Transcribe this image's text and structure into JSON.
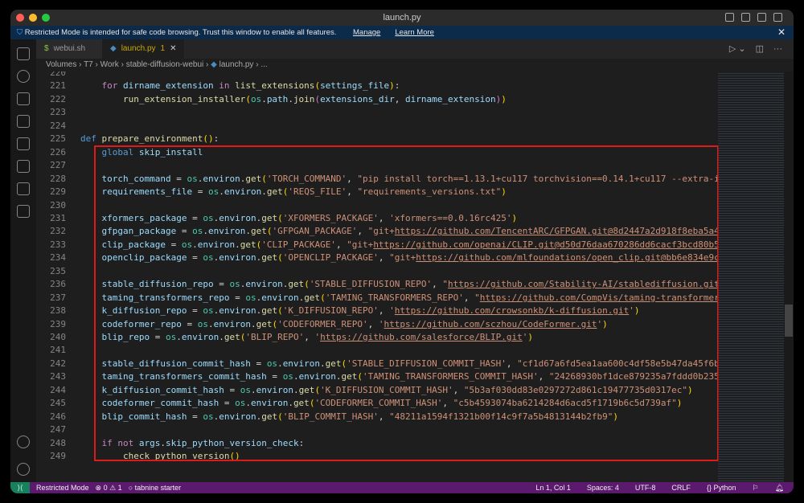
{
  "window": {
    "title": "launch.py"
  },
  "banner": {
    "text": "Restricted Mode is intended for safe code browsing. Trust this window to enable all features.",
    "manage": "Manage",
    "learn_more": "Learn More"
  },
  "tabs": [
    {
      "label": "webui.sh",
      "icon": "$"
    },
    {
      "label": "launch.py",
      "badge": "1"
    }
  ],
  "breadcrumb": [
    "Volumes",
    "T7",
    "Work",
    "stable-diffusion-webui",
    "launch.py",
    "..."
  ],
  "colors": {
    "status_bar": "#5c1a6e",
    "banner": "#0c2a4a",
    "highlight_box": "#e0191b"
  },
  "code": [
    {
      "n": "220",
      "t": []
    },
    {
      "n": "221",
      "t": [
        [
          "t",
          "    "
        ],
        [
          "c",
          "for"
        ],
        [
          "t",
          " "
        ],
        [
          "v",
          "dirname_extension"
        ],
        [
          "t",
          " "
        ],
        [
          "c",
          "in"
        ],
        [
          "t",
          " "
        ],
        [
          "f",
          "list_extensions"
        ],
        [
          "b",
          "("
        ],
        [
          "v",
          "settings_file"
        ],
        [
          "b",
          ")"
        ],
        [
          "t",
          ":"
        ]
      ]
    },
    {
      "n": "222",
      "t": [
        [
          "t",
          "        "
        ],
        [
          "f",
          "run_extension_installer"
        ],
        [
          "b",
          "("
        ],
        [
          "m",
          "os"
        ],
        [
          "t",
          "."
        ],
        [
          "v",
          "path"
        ],
        [
          "t",
          "."
        ],
        [
          "f",
          "join"
        ],
        [
          "p",
          "("
        ],
        [
          "v",
          "extensions_dir"
        ],
        [
          "t",
          ", "
        ],
        [
          "v",
          "dirname_extension"
        ],
        [
          "p",
          ")"
        ],
        [
          "b",
          ")"
        ]
      ]
    },
    {
      "n": "223",
      "t": []
    },
    {
      "n": "224",
      "t": []
    },
    {
      "n": "225",
      "t": [
        [
          "k",
          "def"
        ],
        [
          "t",
          " "
        ],
        [
          "f",
          "prepare_environment"
        ],
        [
          "b",
          "()"
        ],
        [
          "t",
          ":"
        ]
      ]
    },
    {
      "n": "226",
      "t": [
        [
          "t",
          "    "
        ],
        [
          "k",
          "global"
        ],
        [
          "t",
          " "
        ],
        [
          "v",
          "skip_install"
        ]
      ]
    },
    {
      "n": "227",
      "t": []
    },
    {
      "n": "228",
      "t": [
        [
          "t",
          "    "
        ],
        [
          "v",
          "torch_command"
        ],
        [
          "t",
          " = "
        ],
        [
          "m",
          "os"
        ],
        [
          "t",
          "."
        ],
        [
          "v",
          "environ"
        ],
        [
          "t",
          "."
        ],
        [
          "f",
          "get"
        ],
        [
          "b",
          "("
        ],
        [
          "s",
          "'TORCH_COMMAND'"
        ],
        [
          "t",
          ", "
        ],
        [
          "s",
          "\"pip install torch==1.13.1+cu117 torchvision==0.14.1+cu117 --extra-i"
        ]
      ]
    },
    {
      "n": "229",
      "t": [
        [
          "t",
          "    "
        ],
        [
          "v",
          "requirements_file"
        ],
        [
          "t",
          " = "
        ],
        [
          "m",
          "os"
        ],
        [
          "t",
          "."
        ],
        [
          "v",
          "environ"
        ],
        [
          "t",
          "."
        ],
        [
          "f",
          "get"
        ],
        [
          "b",
          "("
        ],
        [
          "s",
          "'REQS_FILE'"
        ],
        [
          "t",
          ", "
        ],
        [
          "s",
          "\"requirements_versions.txt\""
        ],
        [
          "b",
          ")"
        ]
      ]
    },
    {
      "n": "230",
      "t": []
    },
    {
      "n": "231",
      "t": [
        [
          "t",
          "    "
        ],
        [
          "v",
          "xformers_package"
        ],
        [
          "t",
          " = "
        ],
        [
          "m",
          "os"
        ],
        [
          "t",
          "."
        ],
        [
          "v",
          "environ"
        ],
        [
          "t",
          "."
        ],
        [
          "f",
          "get"
        ],
        [
          "b",
          "("
        ],
        [
          "s",
          "'XFORMERS_PACKAGE'"
        ],
        [
          "t",
          ", "
        ],
        [
          "s",
          "'xformers==0.0.16rc425'"
        ],
        [
          "b",
          ")"
        ]
      ]
    },
    {
      "n": "232",
      "t": [
        [
          "t",
          "    "
        ],
        [
          "v",
          "gfpgan_package"
        ],
        [
          "t",
          " = "
        ],
        [
          "m",
          "os"
        ],
        [
          "t",
          "."
        ],
        [
          "v",
          "environ"
        ],
        [
          "t",
          "."
        ],
        [
          "f",
          "get"
        ],
        [
          "b",
          "("
        ],
        [
          "s",
          "'GFPGAN_PACKAGE'"
        ],
        [
          "t",
          ", "
        ],
        [
          "s",
          "\"git+"
        ],
        [
          "u",
          "https://github.com/TencentARC/GFPGAN.git@8d2447a2d918f8eba5a4"
        ]
      ]
    },
    {
      "n": "233",
      "t": [
        [
          "t",
          "    "
        ],
        [
          "v",
          "clip_package"
        ],
        [
          "t",
          " = "
        ],
        [
          "m",
          "os"
        ],
        [
          "t",
          "."
        ],
        [
          "v",
          "environ"
        ],
        [
          "t",
          "."
        ],
        [
          "f",
          "get"
        ],
        [
          "b",
          "("
        ],
        [
          "s",
          "'CLIP_PACKAGE'"
        ],
        [
          "t",
          ", "
        ],
        [
          "s",
          "\"git+"
        ],
        [
          "u",
          "https://github.com/openai/CLIP.git@d50d76daa670286dd6cacf3bcd80b5"
        ]
      ]
    },
    {
      "n": "234",
      "t": [
        [
          "t",
          "    "
        ],
        [
          "v",
          "openclip_package"
        ],
        [
          "t",
          " = "
        ],
        [
          "m",
          "os"
        ],
        [
          "t",
          "."
        ],
        [
          "v",
          "environ"
        ],
        [
          "t",
          "."
        ],
        [
          "f",
          "get"
        ],
        [
          "b",
          "("
        ],
        [
          "s",
          "'OPENCLIP_PACKAGE'"
        ],
        [
          "t",
          ", "
        ],
        [
          "s",
          "\"git+"
        ],
        [
          "u",
          "https://github.com/mlfoundations/open_clip.git@bb6e834e9c"
        ]
      ]
    },
    {
      "n": "235",
      "t": []
    },
    {
      "n": "236",
      "t": [
        [
          "t",
          "    "
        ],
        [
          "v",
          "stable_diffusion_repo"
        ],
        [
          "t",
          " = "
        ],
        [
          "m",
          "os"
        ],
        [
          "t",
          "."
        ],
        [
          "v",
          "environ"
        ],
        [
          "t",
          "."
        ],
        [
          "f",
          "get"
        ],
        [
          "b",
          "("
        ],
        [
          "s",
          "'STABLE_DIFFUSION_REPO'"
        ],
        [
          "t",
          ", "
        ],
        [
          "s",
          "\""
        ],
        [
          "u",
          "https://github.com/Stability-AI/stablediffusion.git"
        ]
      ]
    },
    {
      "n": "237",
      "t": [
        [
          "t",
          "    "
        ],
        [
          "v",
          "taming_transformers_repo"
        ],
        [
          "t",
          " = "
        ],
        [
          "m",
          "os"
        ],
        [
          "t",
          "."
        ],
        [
          "v",
          "environ"
        ],
        [
          "t",
          "."
        ],
        [
          "f",
          "get"
        ],
        [
          "b",
          "("
        ],
        [
          "s",
          "'TAMING_TRANSFORMERS_REPO'"
        ],
        [
          "t",
          ", "
        ],
        [
          "s",
          "\""
        ],
        [
          "u",
          "https://github.com/CompVis/taming-transformer"
        ]
      ]
    },
    {
      "n": "238",
      "t": [
        [
          "t",
          "    "
        ],
        [
          "v",
          "k_diffusion_repo"
        ],
        [
          "t",
          " = "
        ],
        [
          "m",
          "os"
        ],
        [
          "t",
          "."
        ],
        [
          "v",
          "environ"
        ],
        [
          "t",
          "."
        ],
        [
          "f",
          "get"
        ],
        [
          "b",
          "("
        ],
        [
          "s",
          "'K_DIFFUSION_REPO'"
        ],
        [
          "t",
          ", "
        ],
        [
          "s",
          "'"
        ],
        [
          "u",
          "https://github.com/crowsonkb/k-diffusion.git"
        ],
        [
          "s",
          "'"
        ],
        [
          "b",
          ")"
        ]
      ]
    },
    {
      "n": "239",
      "t": [
        [
          "t",
          "    "
        ],
        [
          "v",
          "codeformer_repo"
        ],
        [
          "t",
          " = "
        ],
        [
          "m",
          "os"
        ],
        [
          "t",
          "."
        ],
        [
          "v",
          "environ"
        ],
        [
          "t",
          "."
        ],
        [
          "f",
          "get"
        ],
        [
          "b",
          "("
        ],
        [
          "s",
          "'CODEFORMER_REPO'"
        ],
        [
          "t",
          ", "
        ],
        [
          "s",
          "'"
        ],
        [
          "u",
          "https://github.com/sczhou/CodeFormer.git"
        ],
        [
          "s",
          "'"
        ],
        [
          "b",
          ")"
        ]
      ]
    },
    {
      "n": "240",
      "t": [
        [
          "t",
          "    "
        ],
        [
          "v",
          "blip_repo"
        ],
        [
          "t",
          " = "
        ],
        [
          "m",
          "os"
        ],
        [
          "t",
          "."
        ],
        [
          "v",
          "environ"
        ],
        [
          "t",
          "."
        ],
        [
          "f",
          "get"
        ],
        [
          "b",
          "("
        ],
        [
          "s",
          "'BLIP_REPO'"
        ],
        [
          "t",
          ", "
        ],
        [
          "s",
          "'"
        ],
        [
          "u",
          "https://github.com/salesforce/BLIP.git"
        ],
        [
          "s",
          "'"
        ],
        [
          "b",
          ")"
        ]
      ]
    },
    {
      "n": "241",
      "t": []
    },
    {
      "n": "242",
      "t": [
        [
          "t",
          "    "
        ],
        [
          "v",
          "stable_diffusion_commit_hash"
        ],
        [
          "t",
          " = "
        ],
        [
          "m",
          "os"
        ],
        [
          "t",
          "."
        ],
        [
          "v",
          "environ"
        ],
        [
          "t",
          "."
        ],
        [
          "f",
          "get"
        ],
        [
          "b",
          "("
        ],
        [
          "s",
          "'STABLE_DIFFUSION_COMMIT_HASH'"
        ],
        [
          "t",
          ", "
        ],
        [
          "s",
          "\"cf1d67a6fd5ea1aa600c4df58e5b47da45f6b"
        ]
      ]
    },
    {
      "n": "243",
      "t": [
        [
          "t",
          "    "
        ],
        [
          "v",
          "taming_transformers_commit_hash"
        ],
        [
          "t",
          " = "
        ],
        [
          "m",
          "os"
        ],
        [
          "t",
          "."
        ],
        [
          "v",
          "environ"
        ],
        [
          "t",
          "."
        ],
        [
          "f",
          "get"
        ],
        [
          "b",
          "("
        ],
        [
          "s",
          "'TAMING_TRANSFORMERS_COMMIT_HASH'"
        ],
        [
          "t",
          ", "
        ],
        [
          "s",
          "\"24268930bf1dce879235a7fddd0b235"
        ]
      ]
    },
    {
      "n": "244",
      "t": [
        [
          "t",
          "    "
        ],
        [
          "v",
          "k_diffusion_commit_hash"
        ],
        [
          "t",
          " = "
        ],
        [
          "m",
          "os"
        ],
        [
          "t",
          "."
        ],
        [
          "v",
          "environ"
        ],
        [
          "t",
          "."
        ],
        [
          "f",
          "get"
        ],
        [
          "b",
          "("
        ],
        [
          "s",
          "'K_DIFFUSION_COMMIT_HASH'"
        ],
        [
          "t",
          ", "
        ],
        [
          "s",
          "\"5b3af030dd83e0297272d861c19477735d0317ec\""
        ],
        [
          "b",
          ")"
        ]
      ]
    },
    {
      "n": "245",
      "t": [
        [
          "t",
          "    "
        ],
        [
          "v",
          "codeformer_commit_hash"
        ],
        [
          "t",
          " = "
        ],
        [
          "m",
          "os"
        ],
        [
          "t",
          "."
        ],
        [
          "v",
          "environ"
        ],
        [
          "t",
          "."
        ],
        [
          "f",
          "get"
        ],
        [
          "b",
          "("
        ],
        [
          "s",
          "'CODEFORMER_COMMIT_HASH'"
        ],
        [
          "t",
          ", "
        ],
        [
          "s",
          "\"c5b4593074ba6214284d6acd5f1719b6c5d739af\""
        ],
        [
          "b",
          ")"
        ]
      ]
    },
    {
      "n": "246",
      "t": [
        [
          "t",
          "    "
        ],
        [
          "v",
          "blip_commit_hash"
        ],
        [
          "t",
          " = "
        ],
        [
          "m",
          "os"
        ],
        [
          "t",
          "."
        ],
        [
          "v",
          "environ"
        ],
        [
          "t",
          "."
        ],
        [
          "f",
          "get"
        ],
        [
          "b",
          "("
        ],
        [
          "s",
          "'BLIP_COMMIT_HASH'"
        ],
        [
          "t",
          ", "
        ],
        [
          "s",
          "\"48211a1594f1321b00f14c9f7a5b4813144b2fb9\""
        ],
        [
          "b",
          ")"
        ]
      ]
    },
    {
      "n": "247",
      "t": []
    },
    {
      "n": "248",
      "t": [
        [
          "t",
          "    "
        ],
        [
          "c",
          "if"
        ],
        [
          "t",
          " "
        ],
        [
          "c",
          "not"
        ],
        [
          "t",
          " "
        ],
        [
          "v",
          "args"
        ],
        [
          "t",
          "."
        ],
        [
          "v",
          "skip_python_version_check"
        ],
        [
          "t",
          ":"
        ]
      ]
    },
    {
      "n": "249",
      "t": [
        [
          "t",
          "        "
        ],
        [
          "f",
          "check_python_version"
        ],
        [
          "b",
          "()"
        ]
      ]
    }
  ],
  "status": {
    "mode": "Restricted Mode",
    "errors": "0",
    "warnings": "1",
    "tabnine": "tabnine starter",
    "position": "Ln 1, Col 1",
    "spaces": "Spaces: 4",
    "encoding": "UTF-8",
    "eol": "CRLF",
    "language": "Python"
  }
}
